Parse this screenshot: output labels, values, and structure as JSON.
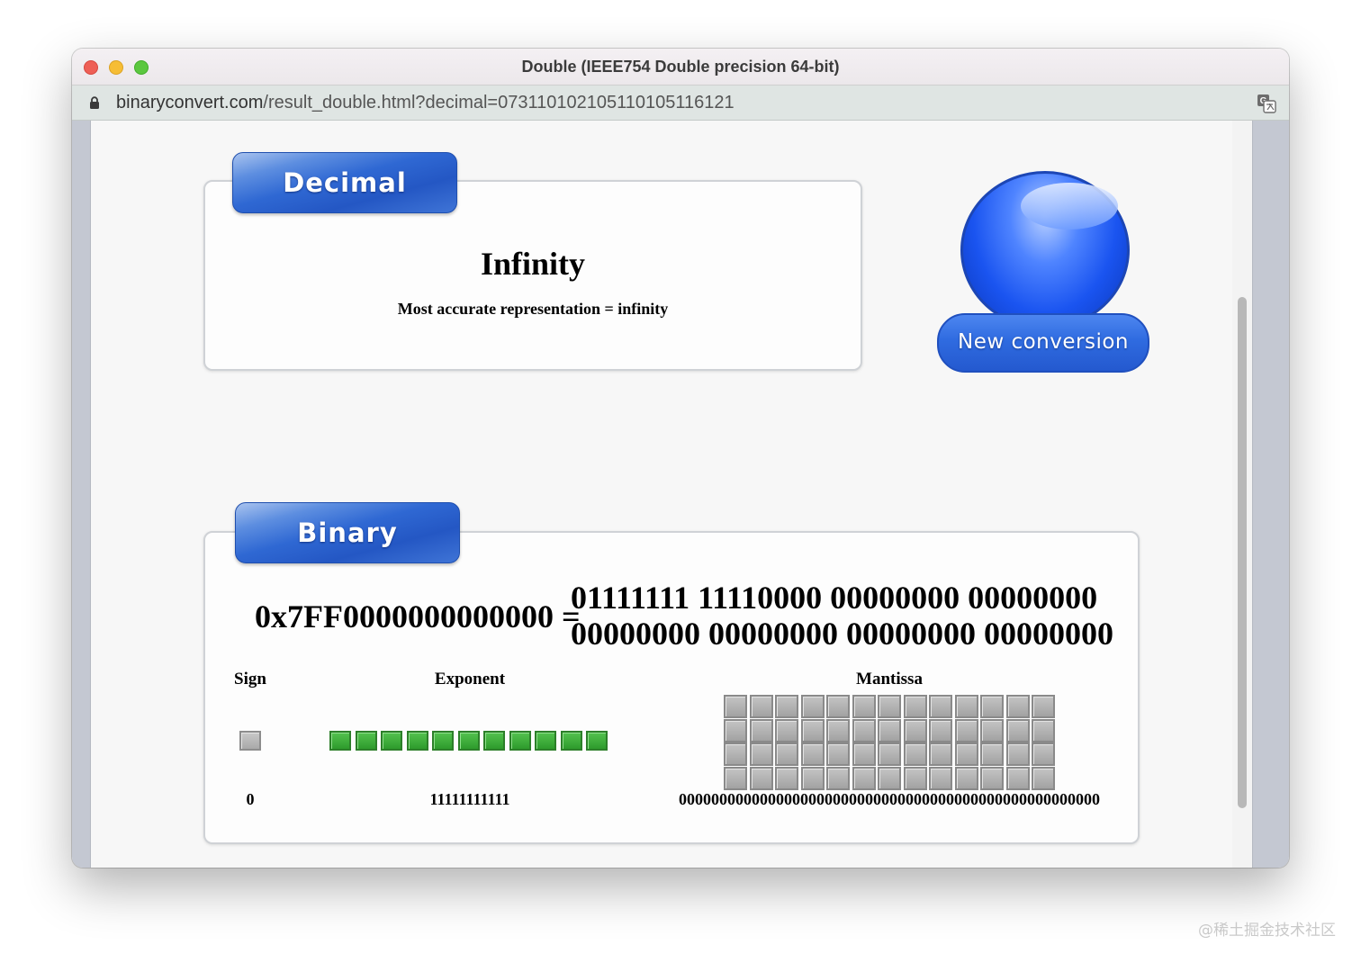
{
  "window": {
    "title": "Double (IEEE754 Double precision 64-bit)",
    "url_host": "binaryconvert.com",
    "url_path": "/result_double.html?decimal=073110102105110105116121"
  },
  "decimal": {
    "tab_label": "Decimal",
    "value": "Infinity",
    "note": "Most accurate representation = infinity"
  },
  "new_conversion": {
    "label": "New conversion"
  },
  "binary": {
    "tab_label": "Binary",
    "hex": "0x7FF0000000000000 =",
    "bits_line1": "01111111 11110000 00000000 00000000",
    "bits_line2": "00000000 00000000 00000000 00000000",
    "sign": {
      "label": "Sign",
      "value": "0",
      "bits": [
        0
      ]
    },
    "exponent": {
      "label": "Exponent",
      "value": "11111111111",
      "bits": [
        1,
        1,
        1,
        1,
        1,
        1,
        1,
        1,
        1,
        1,
        1
      ]
    },
    "mantissa": {
      "label": "Mantissa",
      "value": "0000000000000000000000000000000000000000000000000000",
      "rows": 4,
      "cols": 13
    }
  },
  "colors": {
    "bit_on": "#3aa836",
    "bit_off": "#b5b5b5",
    "tab_blue": "#2f68d3"
  },
  "watermark": "@稀土掘金技术社区"
}
